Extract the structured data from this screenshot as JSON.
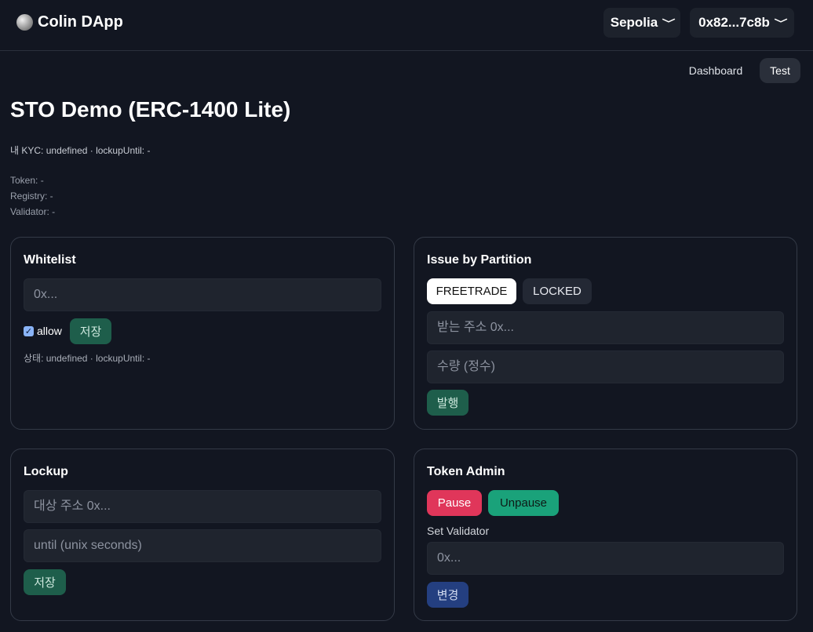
{
  "app": {
    "name": "Colin DApp",
    "logo_icon": "moon-icon"
  },
  "header": {
    "network": "Sepolia",
    "account": "0x82...7c8b",
    "chevron": "❯"
  },
  "nav": {
    "dashboard": "Dashboard",
    "test": "Test"
  },
  "page": {
    "title": "STO Demo (ERC-1400 Lite)",
    "kyc_line": "내 KYC: undefined · lockupUntil: -",
    "token": "Token: -",
    "registry": "Registry: -",
    "validator": "Validator: -"
  },
  "whitelist": {
    "title": "Whitelist",
    "address_placeholder": "0x...",
    "allow_label": "allow",
    "allow_checked": true,
    "save_label": "저장",
    "status": "상태: undefined · lockupUntil: -"
  },
  "issue": {
    "title": "Issue by Partition",
    "partitions": [
      "FREETRADE",
      "LOCKED"
    ],
    "selected_partition": "FREETRADE",
    "to_placeholder": "받는 주소 0x...",
    "amount_placeholder": "수량 (정수)",
    "issue_label": "발행"
  },
  "lockup": {
    "title": "Lockup",
    "target_placeholder": "대상 주소 0x...",
    "until_placeholder": "until (unix seconds)",
    "save_label": "저장"
  },
  "admin": {
    "title": "Token Admin",
    "pause_label": "Pause",
    "unpause_label": "Unpause",
    "set_validator_label": "Set Validator",
    "validator_placeholder": "0x...",
    "change_label": "변경"
  },
  "colors": {
    "background": "#121621",
    "pause": "#e0365a",
    "unpause": "#1aa27a",
    "save": "#1e5e4b",
    "change": "#243f80"
  }
}
